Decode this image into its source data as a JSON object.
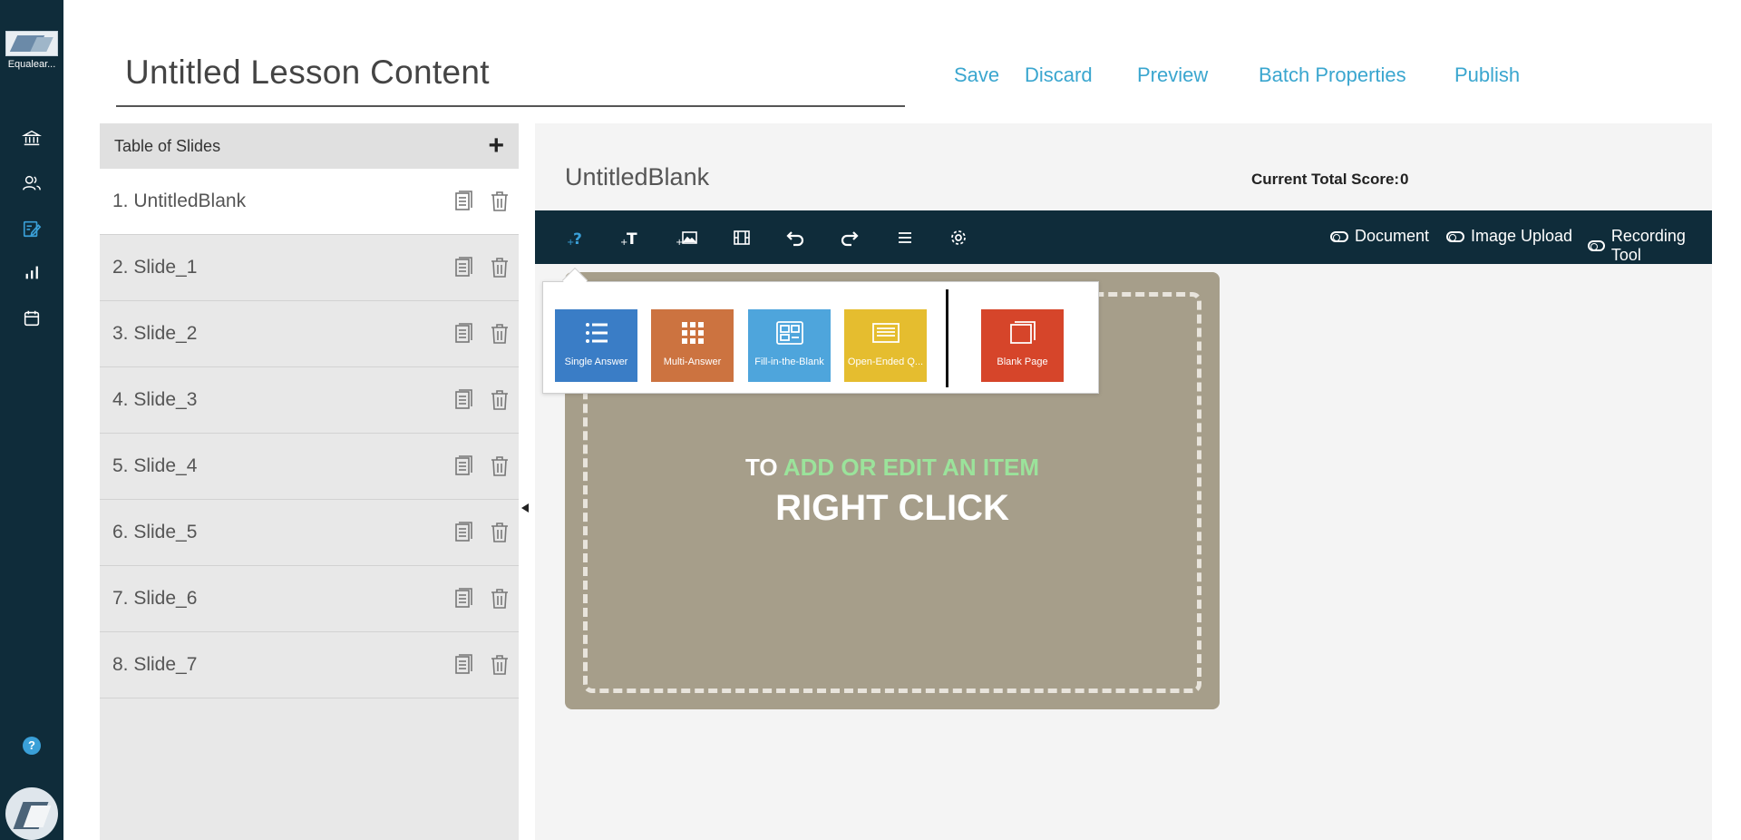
{
  "rail": {
    "logo_text": "Equalear...",
    "items": [
      "bank-icon",
      "users-icon",
      "edit-icon",
      "chart-icon",
      "calendar-icon"
    ],
    "help": "?",
    "active_color": "#3aa0d8"
  },
  "header": {
    "title": "Untitled Lesson Content",
    "actions": {
      "save": "Save",
      "discard": "Discard",
      "preview": "Preview",
      "batch": "Batch Properties",
      "publish": "Publish"
    }
  },
  "slides_panel": {
    "title": "Table of Slides",
    "add": "+",
    "slides": [
      "1. UntitledBlank",
      "2. Slide_1",
      "3. Slide_2",
      "4. Slide_3",
      "5. Slide_4",
      "6. Slide_5",
      "7. Slide_6",
      "8. Slide_7"
    ]
  },
  "editor": {
    "slide_name": "UntitledBlank",
    "score_label": "Current Total Score:",
    "score_value": "0",
    "toolbar": {
      "tools": [
        "add-question-icon",
        "add-text-icon",
        "add-image-icon",
        "film-icon",
        "undo-icon",
        "redo-icon",
        "list-icon",
        "settings-icon"
      ],
      "toggles": {
        "document": "Document",
        "image_upload": "Image Upload",
        "recording": "Recording Tool"
      }
    },
    "canvas": {
      "hint_to": "TO",
      "hint_action": "ADD OR EDIT AN ITEM",
      "hint_main": "RIGHT CLICK"
    },
    "popup": {
      "tiles": [
        {
          "label": "Single Answer",
          "color": "#3a7dc6"
        },
        {
          "label": "Multi-Answer",
          "color": "#cc7340"
        },
        {
          "label": "Fill-in-the-Blank",
          "color": "#4ea5dc"
        },
        {
          "label": "Open-Ended Q...",
          "color": "#e5bd2f"
        },
        {
          "label": "Blank Page",
          "color": "#d6452a"
        }
      ]
    }
  }
}
